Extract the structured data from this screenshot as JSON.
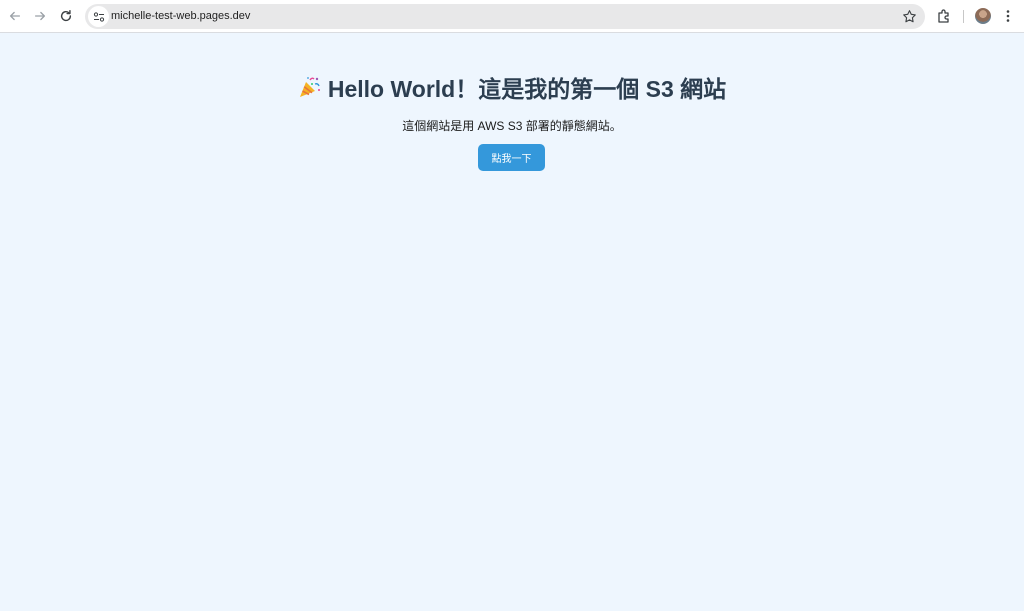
{
  "browser": {
    "url": "michelle-test-web.pages.dev",
    "icons": {
      "back": "arrow-left-icon",
      "forward": "arrow-right-icon",
      "reload": "reload-icon",
      "site_info": "tune-icon",
      "bookmark": "star-icon",
      "extensions": "puzzle-icon",
      "profile": "avatar",
      "menu": "kebab-menu-icon"
    }
  },
  "page": {
    "heading_icon": "party-popper-icon",
    "heading": "Hello World！這是我的第一個 S3 網站",
    "subtitle": "這個網站是用 AWS S3 部署的靜態網站。",
    "button_label": "點我一下",
    "colors": {
      "background": "#eef6fe",
      "heading": "#2c3e50",
      "button": "#3498db"
    }
  }
}
